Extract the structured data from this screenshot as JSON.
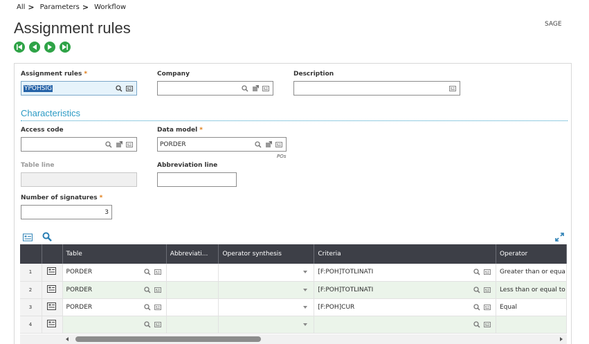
{
  "breadcrumb": {
    "items": [
      "All",
      "Parameters",
      "Workflow"
    ],
    "separator": ">"
  },
  "page": {
    "title": "Assignment rules",
    "company_code": "SAGE"
  },
  "colors": {
    "accent": "#2b9ac4",
    "nav_green": "#2fa347",
    "grid_header": "#3d3f47",
    "required": "#e07a12",
    "selection": "#2563a8"
  },
  "form": {
    "assignment_rules": {
      "label": "Assignment rules",
      "value": "YPOHSIG"
    },
    "company": {
      "label": "Company",
      "value": ""
    },
    "description": {
      "label": "Description",
      "value": ""
    },
    "section_title": "Characteristics",
    "access_code": {
      "label": "Access code",
      "value": ""
    },
    "data_model": {
      "label": "Data model",
      "value": "PORDER",
      "note": "POs"
    },
    "table_line": {
      "label": "Table line",
      "value": ""
    },
    "abbreviation_line": {
      "label": "Abbreviation line",
      "value": ""
    },
    "number_of_signatures": {
      "label": "Number of signatures",
      "value": "3"
    }
  },
  "grid": {
    "columns": [
      "Table",
      "Abbreviati...",
      "Operator synthesis",
      "Criteria",
      "Operator"
    ],
    "rows": [
      {
        "num": "1",
        "table": "PORDER",
        "abbreviation": "",
        "operator_synthesis": "",
        "criteria": "[F:POH]TOTLINATI",
        "operator": "Greater than or equa"
      },
      {
        "num": "2",
        "table": "PORDER",
        "abbreviation": "",
        "operator_synthesis": "",
        "criteria": "[F:POH]TOTLINATI",
        "operator": "Less than or equal to"
      },
      {
        "num": "3",
        "table": "PORDER",
        "abbreviation": "",
        "operator_synthesis": "",
        "criteria": "[F:POH]CUR",
        "operator": "Equal"
      },
      {
        "num": "4",
        "table": "",
        "abbreviation": "",
        "operator_synthesis": "",
        "criteria": "",
        "operator": ""
      }
    ]
  }
}
